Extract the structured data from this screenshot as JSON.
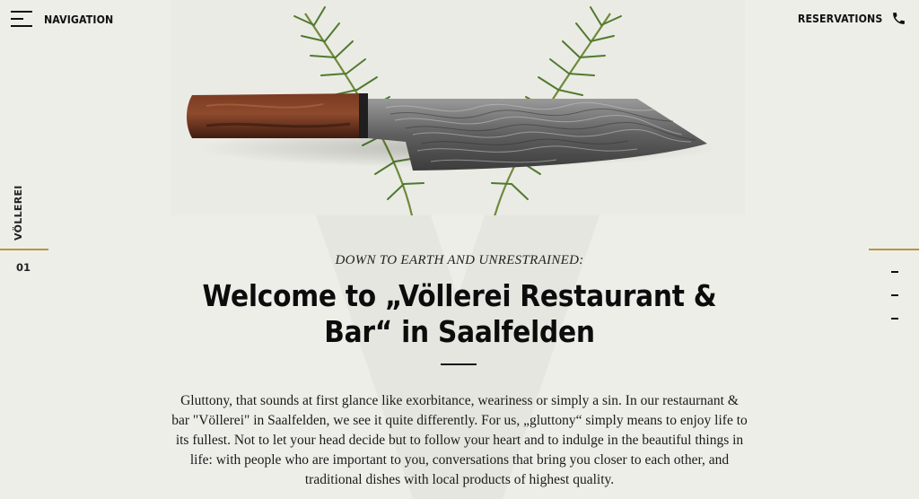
{
  "header": {
    "navigation_label": "NAVIGATION",
    "reservations_label": "RESERVATIONS"
  },
  "side": {
    "section_label": "VÖLLEREI",
    "section_number": "01",
    "accent_color": "#b9953f"
  },
  "hero": {
    "kicker": "DOWN TO EARTH AND UNRESTRAINED:",
    "title": "Welcome to „Völlerei Restaurant & Bar“ in Saalfelden",
    "body": "Gluttony, that sounds at first glance like exorbitance, weariness or simply a sin. In our restaurnant & bar \"Völlerei\" in Saalfelden, we see it quite differently. For us, „gluttony“ simply means to enjoy life to its fullest. Not to let your head decide but to follow your heart and to indulge in the beautiful things in life: with people who are important to you, conversations that bring you closer to each other, and traditional dishes with local products of highest quality."
  },
  "icons": {
    "menu": "hamburger-menu-icon",
    "phone": "phone-icon",
    "image": "damascus-knife-with-rosemary"
  },
  "colors": {
    "background": "#eeeee9",
    "text": "#111111",
    "accent": "#b9953f"
  }
}
